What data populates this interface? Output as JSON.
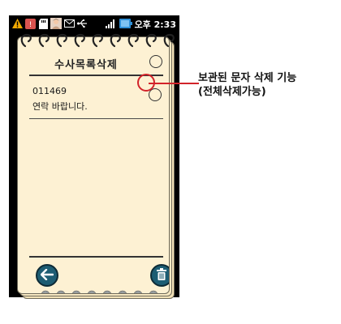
{
  "status_bar": {
    "time": "오후 2:33",
    "icons": [
      "warning-icon",
      "notification-icon",
      "sd-card-icon",
      "contact-avatar-icon",
      "mail-icon",
      "usb-icon",
      "signal-icon",
      "battery-icon"
    ]
  },
  "screen": {
    "title": "수사목록삭제",
    "messages": [
      {
        "number": "011469",
        "body": "연락 바랍니다."
      }
    ],
    "buttons": {
      "back": "back-arrow-icon",
      "delete": "trash-icon"
    }
  },
  "callout": {
    "line1": "보관된 문자 삭제 기능",
    "line2": "(전체삭제가능)",
    "color": "#d2232a"
  },
  "colors": {
    "paper": "#fdf1d3",
    "button": "#1d5d73"
  }
}
